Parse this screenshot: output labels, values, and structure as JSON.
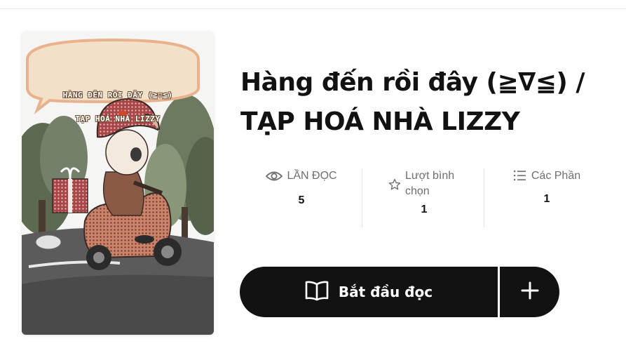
{
  "cover": {
    "bubble_line1": "HÀNG ĐẾN RỒI ĐÂY (≧▽≦)",
    "bubble_line2": "TẠP HOÁ NHÀ LIZZY"
  },
  "story": {
    "title": "Hàng đến rồi đây (≧∇≦) / TẠP HOÁ NHÀ LIZZY"
  },
  "stats": {
    "reads": {
      "label": "LẦN ĐỌC",
      "value": "5",
      "icon": "eye-icon"
    },
    "votes": {
      "label": "Lượt bình chọn",
      "value": "1",
      "icon": "star-icon"
    },
    "parts": {
      "label": "Các Phần",
      "value": "1",
      "icon": "list-icon"
    }
  },
  "actions": {
    "start_label": "Bắt đầu đọc",
    "start_icon": "book-icon",
    "add_icon": "plus-icon"
  },
  "colors": {
    "button_bg": "#121212",
    "text_muted": "#6f6f6f"
  }
}
